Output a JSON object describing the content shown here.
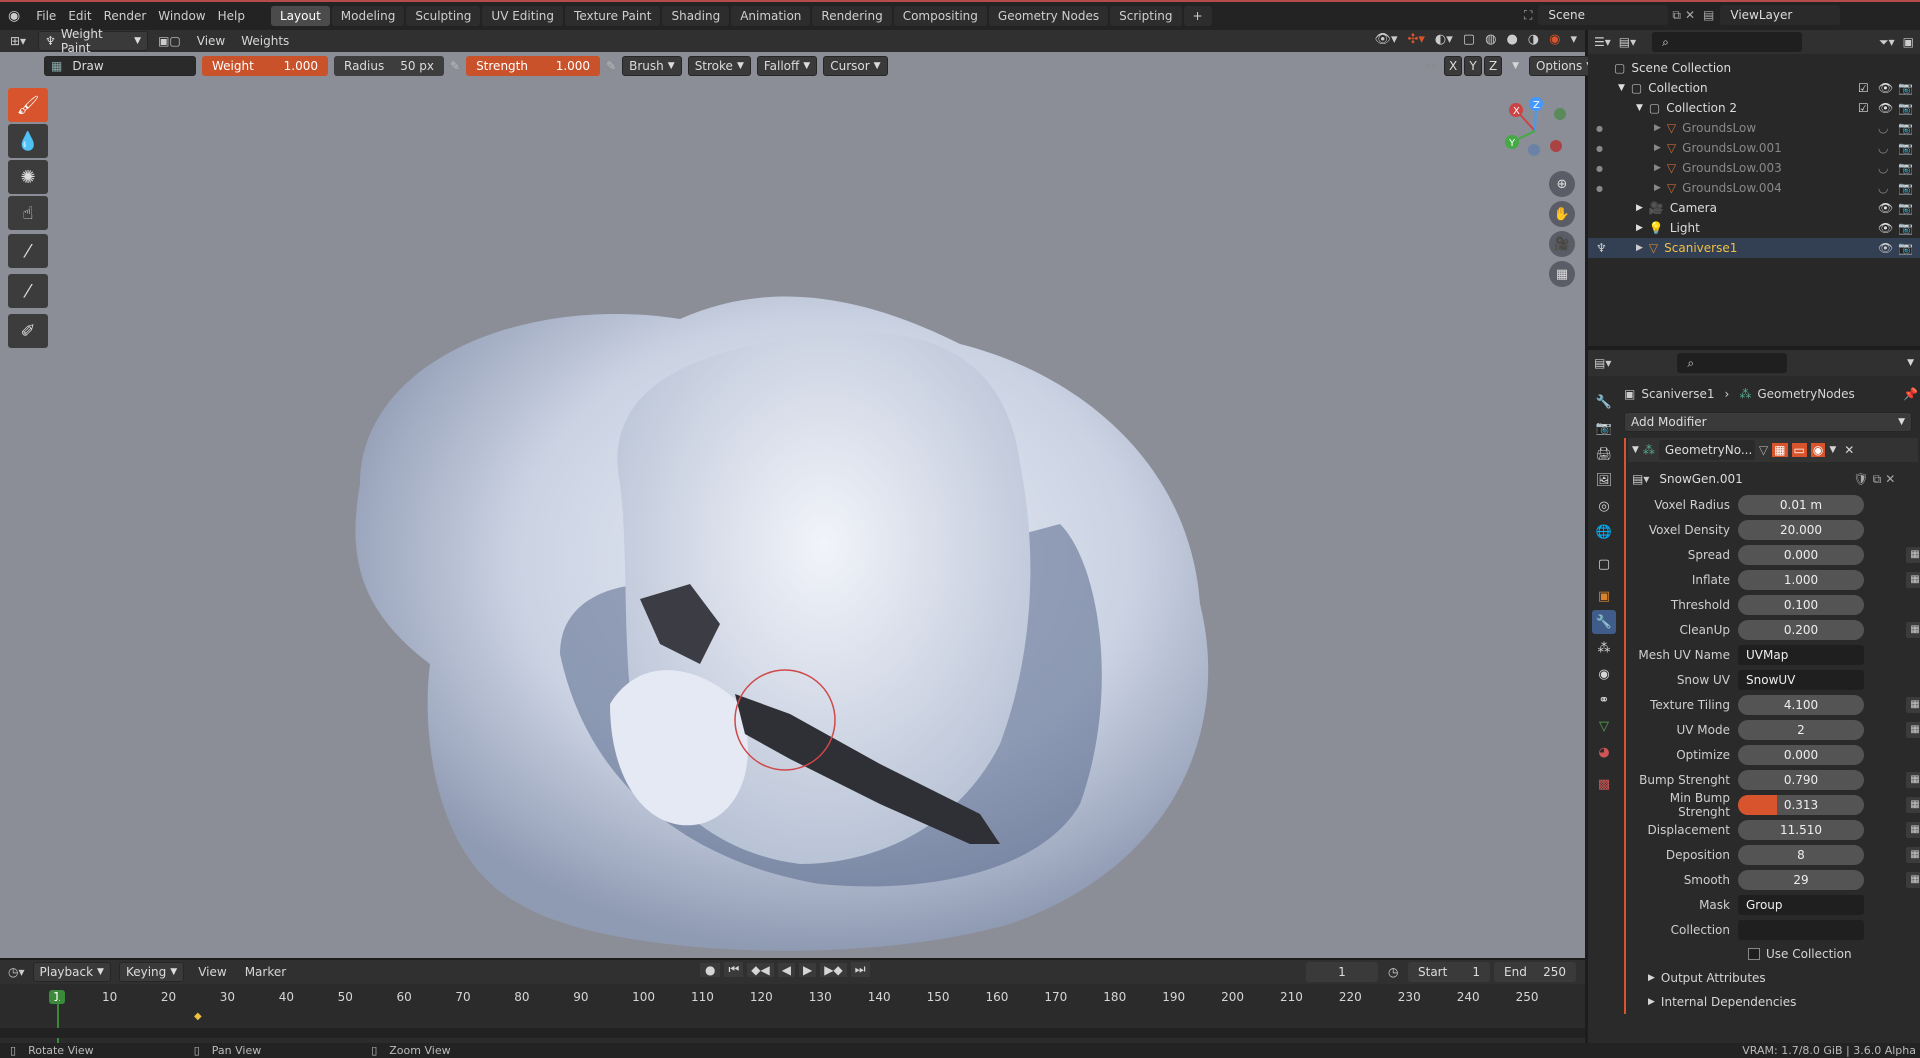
{
  "menu": [
    "File",
    "Edit",
    "Render",
    "Window",
    "Help"
  ],
  "workspaces": [
    "Layout",
    "Modeling",
    "Sculpting",
    "UV Editing",
    "Texture Paint",
    "Shading",
    "Animation",
    "Rendering",
    "Compositing",
    "Geometry Nodes",
    "Scripting"
  ],
  "active_workspace": "Layout",
  "scene": {
    "label": "Scene",
    "view_layer": "ViewLayer"
  },
  "header": {
    "mode": "Weight Paint",
    "view": "View",
    "weights": "Weights"
  },
  "toolsettings": {
    "brush_name": "Draw",
    "weight_label": "Weight",
    "weight_value": "1.000",
    "radius_label": "Radius",
    "radius_value": "50 px",
    "strength_label": "Strength",
    "strength_value": "1.000",
    "brush": "Brush",
    "stroke": "Stroke",
    "falloff": "Falloff",
    "cursor": "Cursor",
    "options": "Options",
    "axes": [
      "X",
      "Y",
      "Z"
    ]
  },
  "gizmo": {
    "x": "X",
    "y": "Y",
    "z": "Z"
  },
  "outliner": {
    "scene_collection": "Scene Collection",
    "collection": "Collection",
    "collection2": "Collection 2",
    "items": [
      "GroundsLow",
      "GroundsLow.001",
      "GroundsLow.003",
      "GroundsLow.004"
    ],
    "camera": "Camera",
    "light": "Light",
    "active_object": "Scaniverse1"
  },
  "properties": {
    "breadcrumb_object": "Scaniverse1",
    "breadcrumb_modifier": "GeometryNodes",
    "add_modifier": "Add Modifier",
    "modifier_name": "GeometryNo...",
    "node_group": "SnowGen.001",
    "fields": [
      {
        "label": "Voxel Radius",
        "value": "0.01 m",
        "grid": false
      },
      {
        "label": "Voxel Density",
        "value": "20.000",
        "grid": false
      },
      {
        "label": "Spread",
        "value": "0.000",
        "grid": true
      },
      {
        "label": "Inflate",
        "value": "1.000",
        "grid": true
      },
      {
        "label": "Threshold",
        "value": "0.100",
        "grid": false
      },
      {
        "label": "CleanUp",
        "value": "0.200",
        "grid": true
      },
      {
        "label": "Mesh UV Name",
        "value": "UVMap",
        "text": true
      },
      {
        "label": "Snow UV",
        "value": "SnowUV",
        "text": true
      },
      {
        "label": "Texture Tiling",
        "value": "4.100",
        "grid": true
      },
      {
        "label": "UV Mode",
        "value": "2",
        "grid": true
      },
      {
        "label": "Optimize",
        "value": "0.000",
        "grid": false
      },
      {
        "label": "Bump Strenght",
        "value": "0.790",
        "grid": true
      },
      {
        "label": "Min Bump Strenght",
        "value": "0.313",
        "grid": true,
        "fill": 0.313
      },
      {
        "label": "Displacement",
        "value": "11.510",
        "grid": true
      },
      {
        "label": "Deposition",
        "value": "8",
        "grid": true
      },
      {
        "label": "Smooth",
        "value": "29",
        "grid": true
      },
      {
        "label": "Mask",
        "value": "Group",
        "text": true
      },
      {
        "label": "Collection",
        "value": "",
        "text": true
      }
    ],
    "use_collection": "Use Collection",
    "output_attributes": "Output Attributes",
    "internal_dependencies": "Internal Dependencies"
  },
  "timeline": {
    "playback": "Playback",
    "keying": "Keying",
    "view": "View",
    "marker": "Marker",
    "current_frame": "1",
    "start_label": "Start",
    "start": "1",
    "end_label": "End",
    "end": "250",
    "ticks": [
      "1",
      "10",
      "20",
      "30",
      "40",
      "50",
      "60",
      "70",
      "80",
      "90",
      "100",
      "110",
      "120",
      "130",
      "140",
      "150",
      "160",
      "170",
      "180",
      "190",
      "200",
      "210",
      "220",
      "230",
      "240",
      "250"
    ]
  },
  "status": {
    "rotate": "Rotate View",
    "pan": "Pan View",
    "zoom": "Zoom View",
    "vram": "VRAM: 1.7/8.0 GiB | 3.6.0 Alpha"
  },
  "colors": {
    "accent": "#d8542d",
    "selected": "#f0c040"
  }
}
